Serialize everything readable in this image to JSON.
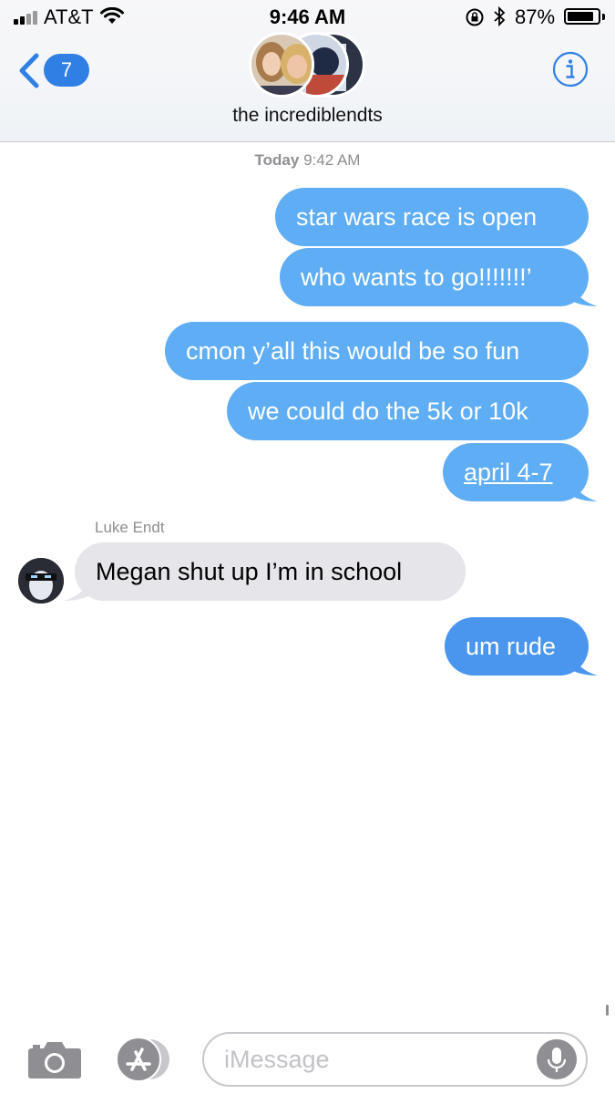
{
  "status_bar": {
    "carrier": "AT&T",
    "time": "9:46 AM",
    "battery_percent_text": "87%",
    "battery_level": 0.87
  },
  "nav": {
    "back_badge": "7",
    "group_name": "the incrediblendts",
    "info_icon": "info-icon"
  },
  "conversation": {
    "timestamp_day": "Today",
    "timestamp_time": "9:42 AM",
    "messages": [
      {
        "text": "star wars race is open"
      },
      {
        "text": "who wants to go!!!!!!!’"
      },
      {
        "text": "cmon y’all this would be so fun"
      },
      {
        "text": "we could do the 5k or 10k"
      },
      {
        "text": "april 4-7"
      },
      {
        "sender": "Luke Endt",
        "text": "Megan shut up I’m in school"
      },
      {
        "text": "um rude"
      }
    ]
  },
  "input": {
    "placeholder": "iMessage",
    "camera_icon": "camera-icon",
    "apps_icon": "app-store-icon",
    "mic_icon": "microphone-icon"
  },
  "colors": {
    "outgoing_bubble": "#5fadf5",
    "incoming_bubble": "#e5e5ea",
    "accent": "#2f7fe5"
  }
}
